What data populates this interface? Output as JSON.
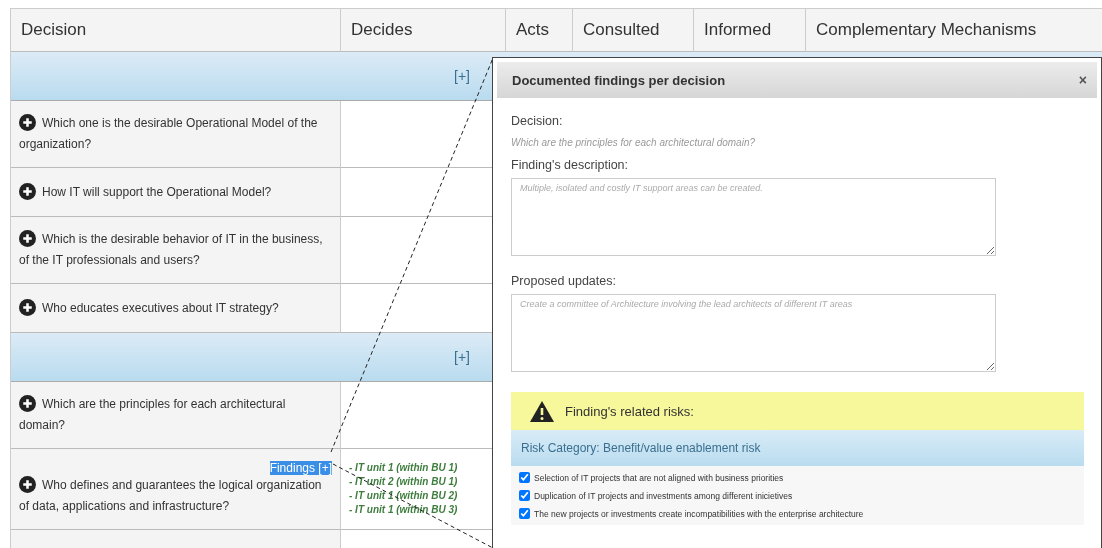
{
  "table": {
    "columns": [
      "Decision",
      "Decides",
      "Acts",
      "Consulted",
      "Informed",
      "Complementary Mechanisms"
    ],
    "rows": [
      {
        "kind": "group",
        "actions": [
          "[+]"
        ]
      },
      {
        "kind": "decision",
        "text": "Which one is the desirable Operational Model of the organization?"
      },
      {
        "kind": "decision",
        "text": "How IT will support the Operational Model?"
      },
      {
        "kind": "decision",
        "text": "Which is the desirable behavior of IT in the business, of the IT professionals and users?"
      },
      {
        "kind": "decision",
        "text": "Who educates executives about IT strategy?"
      },
      {
        "kind": "group",
        "actions": [
          "[+]"
        ]
      },
      {
        "kind": "decision",
        "text": "Which are the principles for each architectural domain?"
      },
      {
        "kind": "decision",
        "text": "Who defines and guarantees the logical organization of data, applications and infrastructure?",
        "findings_link": "Findings [+]",
        "decides": [
          "- IT unit 1 (within BU 1)",
          "- IT unit 2 (within BU 1)",
          "- IT unit 1 (within BU 2)",
          "- IT unit 1 (within BU 3)"
        ]
      },
      {
        "kind": "empty"
      }
    ]
  },
  "dialog": {
    "title": "Documented findings per decision",
    "close": "×",
    "fields": [
      {
        "kind": "text",
        "label": "Decision:",
        "value": "Which are the principles for each architectural domain?"
      },
      {
        "kind": "textarea",
        "label": "Finding's description:",
        "placeholder": "Multiple, isolated and costly IT support areas can be created."
      },
      {
        "kind": "textarea",
        "label": "Proposed updates:",
        "placeholder": "Create a committee of Architecture involving the lead architects of different IT areas"
      }
    ],
    "risks": {
      "title": "Finding's related risks:",
      "category": "Risk Category: Benefit/value enablement risk",
      "items": [
        {
          "label": "Selection of IT projects that are not aligned with business priorities",
          "checked": true
        },
        {
          "label": "Duplication of IT projects and investments among different inicietives",
          "checked": true
        },
        {
          "label": "The new projects or investments create incompatibilities with the enterprise architecture",
          "checked": true
        }
      ]
    }
  }
}
